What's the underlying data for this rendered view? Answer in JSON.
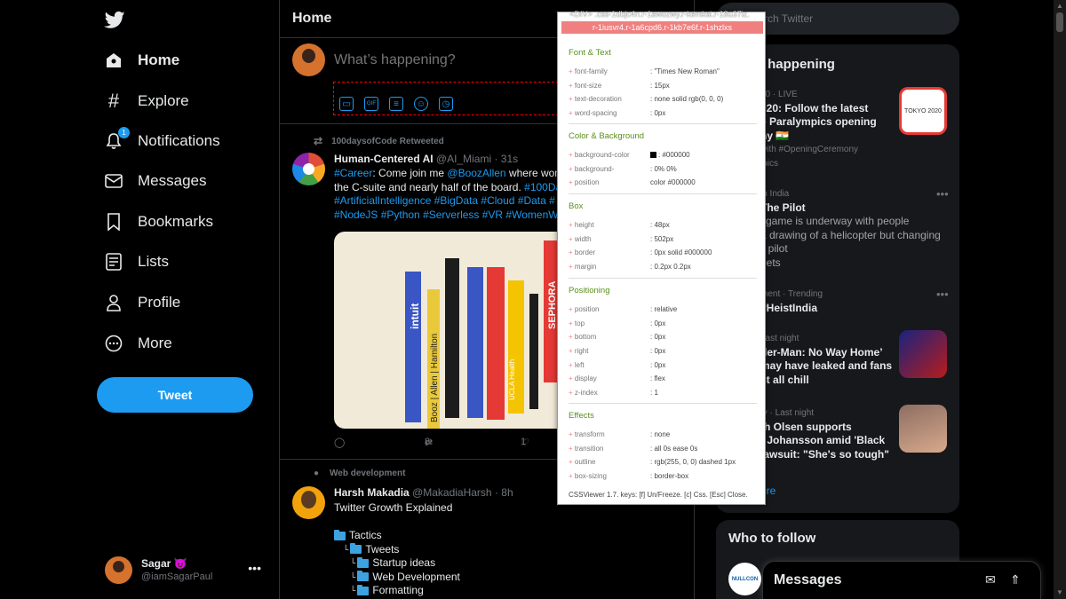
{
  "nav": {
    "items": [
      {
        "label": "Home",
        "icon": "home-icon"
      },
      {
        "label": "Explore",
        "icon": "hashtag-icon"
      },
      {
        "label": "Notifications",
        "icon": "bell-icon",
        "badge": "1"
      },
      {
        "label": "Messages",
        "icon": "envelope-icon"
      },
      {
        "label": "Bookmarks",
        "icon": "bookmark-icon"
      },
      {
        "label": "Lists",
        "icon": "list-icon"
      },
      {
        "label": "Profile",
        "icon": "person-icon"
      },
      {
        "label": "More",
        "icon": "more-circle-icon"
      }
    ],
    "tweet_button": "Tweet",
    "account": {
      "name": "Sagar 😈",
      "handle": "@iamSagarPaul",
      "more": "•••"
    }
  },
  "main": {
    "title": "Home",
    "compose_placeholder": "What’s happening?"
  },
  "tweet1": {
    "retweeted_by": "100daysofCode Retweeted",
    "author": "Human-Centered AI",
    "handle": "@AI_Miami",
    "time": "· 31s",
    "line1_tag": "#Career",
    "line1_text": ": Come join me ",
    "line1_mention": "@BoozAllen",
    "line1_text2": " where wome",
    "line2_text": "the C-suite and nearly half of the board. ",
    "line2_tag": "#100Da",
    "line3": "#ArtificialIntelligence #BigData #Cloud #Data #",
    "line4": "#NodeJS #Python #Serverless #VR #WomenWh",
    "retweets": "8",
    "likes": "1",
    "media_texts": [
      "Booz | Allen | Hamilton",
      "UCLA Health",
      "intuit",
      "SEPHORA"
    ]
  },
  "tweet2": {
    "topic": "Web development",
    "author": "Harsh Makadia",
    "handle": "@MakadiaHarsh",
    "time": "· 8h",
    "text": "Twitter Growth Explained",
    "tree": [
      {
        "prefix": "",
        "label": "Tactics"
      },
      {
        "prefix": "└",
        "label": "Tweets"
      },
      {
        "prefix": "└",
        "label": "Startup ideas"
      },
      {
        "prefix": "└",
        "label": "Web Development"
      },
      {
        "prefix": "└",
        "label": "Formatting"
      }
    ]
  },
  "right": {
    "search_placeholder": "rch Twitter",
    "happening_title": "’s happening",
    "trends": [
      {
        "meta": "20 · LIVE",
        "title": "020: Follow the latest\ne Paralympics opening\nny 🇮🇳",
        "extra": "with #OpeningCeremony\nipics",
        "thumb_text": "TOKYO 2020"
      },
      {
        "meta": "in India",
        "title": "The Pilot",
        "extra": "i game is underway with people\na drawing of a helicopter but changing\nji pilot\neets"
      },
      {
        "meta": "ment · Trending",
        "title": "yHeistIndia"
      },
      {
        "meta": "Last night",
        "title": "der-Man: No Way Home’\nmay have leaked and fans\nst all chill"
      },
      {
        "meta": "ty · Last night",
        "title": "th Olsen supports\nt Johansson amid 'Black\nlawsuit: \"She's so tough\""
      }
    ],
    "show_more": "ore",
    "who_to_follow": "Who to follow",
    "nullcon": "NULLCON",
    "messages_dock": "Messages"
  },
  "cssviewer": {
    "header_top": "<DIV> .css-1dbjc4n.r-1awozwy.r-kemksi.r-18u37iz.",
    "header": "r-1iusvr4.r-1a6cpd6.r-1kb7e6f.r-1shzlxs",
    "sections": [
      {
        "title": "Font & Text",
        "rows": [
          [
            "font-family",
            ": \"Times New Roman\""
          ],
          [
            "font-size",
            ": 15px"
          ],
          [
            "text-decoration",
            ": none solid rgb(0, 0, 0)"
          ],
          [
            "word-spacing",
            ": 0px"
          ]
        ]
      },
      {
        "title": "Color & Background",
        "rows": [
          [
            "background-color",
            ": #000000"
          ],
          [
            "background-",
            ": 0% 0%"
          ],
          [
            "position",
            "color    #000000"
          ]
        ]
      },
      {
        "title": "Box",
        "rows": [
          [
            "height",
            ": 48px"
          ],
          [
            "width",
            ": 502px"
          ],
          [
            "border",
            ": 0px solid #000000"
          ],
          [
            "margin",
            ": 0.2px 0.2px"
          ]
        ]
      },
      {
        "title": "Positioning",
        "rows": [
          [
            "position",
            ": relative"
          ],
          [
            "top",
            ": 0px"
          ],
          [
            "bottom",
            ": 0px"
          ],
          [
            "right",
            ": 0px"
          ],
          [
            "left",
            ": 0px"
          ],
          [
            "display",
            ": flex"
          ],
          [
            "z-index",
            ": 1"
          ]
        ]
      },
      {
        "title": "Effects",
        "rows": [
          [
            "transform",
            ": none"
          ],
          [
            "transition",
            ": all 0s ease 0s"
          ],
          [
            "outline",
            ": rgb(255, 0, 0) dashed 1px"
          ],
          [
            "box-sizing",
            ": border-box"
          ]
        ]
      }
    ],
    "footer": "CSSViewer 1.7. keys: [f] Un/Freeze. [c] Css. [Esc] Close."
  },
  "colors": {
    "accent": "#1d9bf0",
    "background": "#000000",
    "panel": "#16181c",
    "cssviewer_header": "#f08080",
    "cssviewer_section": "#5a8f1b"
  }
}
